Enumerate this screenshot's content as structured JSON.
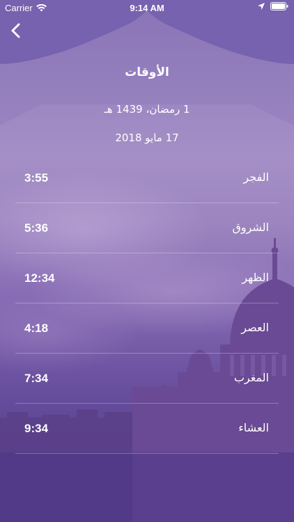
{
  "status_bar": {
    "carrier": "Carrier",
    "time": "9:14 AM",
    "icons": [
      "wifi-icon",
      "location-arrow-icon",
      "battery-icon"
    ]
  },
  "header": {
    "back_icon": "chevron-left-icon",
    "title": "الأوقات"
  },
  "dates": {
    "hijri": "1 رمضان، 1439 هـ",
    "gregorian": "17 مايو 2018"
  },
  "prayers": [
    {
      "name": "الفجر",
      "time": "3:55"
    },
    {
      "name": "الشروق",
      "time": "5:36"
    },
    {
      "name": "الظهر",
      "time": "12:34"
    },
    {
      "name": "العصر",
      "time": "4:18"
    },
    {
      "name": "المغرب",
      "time": "7:34"
    },
    {
      "name": "العشاء",
      "time": "9:34"
    }
  ],
  "colors": {
    "background_top": "#8a73b6",
    "background_bottom": "#4c3788",
    "frame": "#7560ad",
    "mosque": "#5a3f86",
    "text": "#ffffff"
  }
}
